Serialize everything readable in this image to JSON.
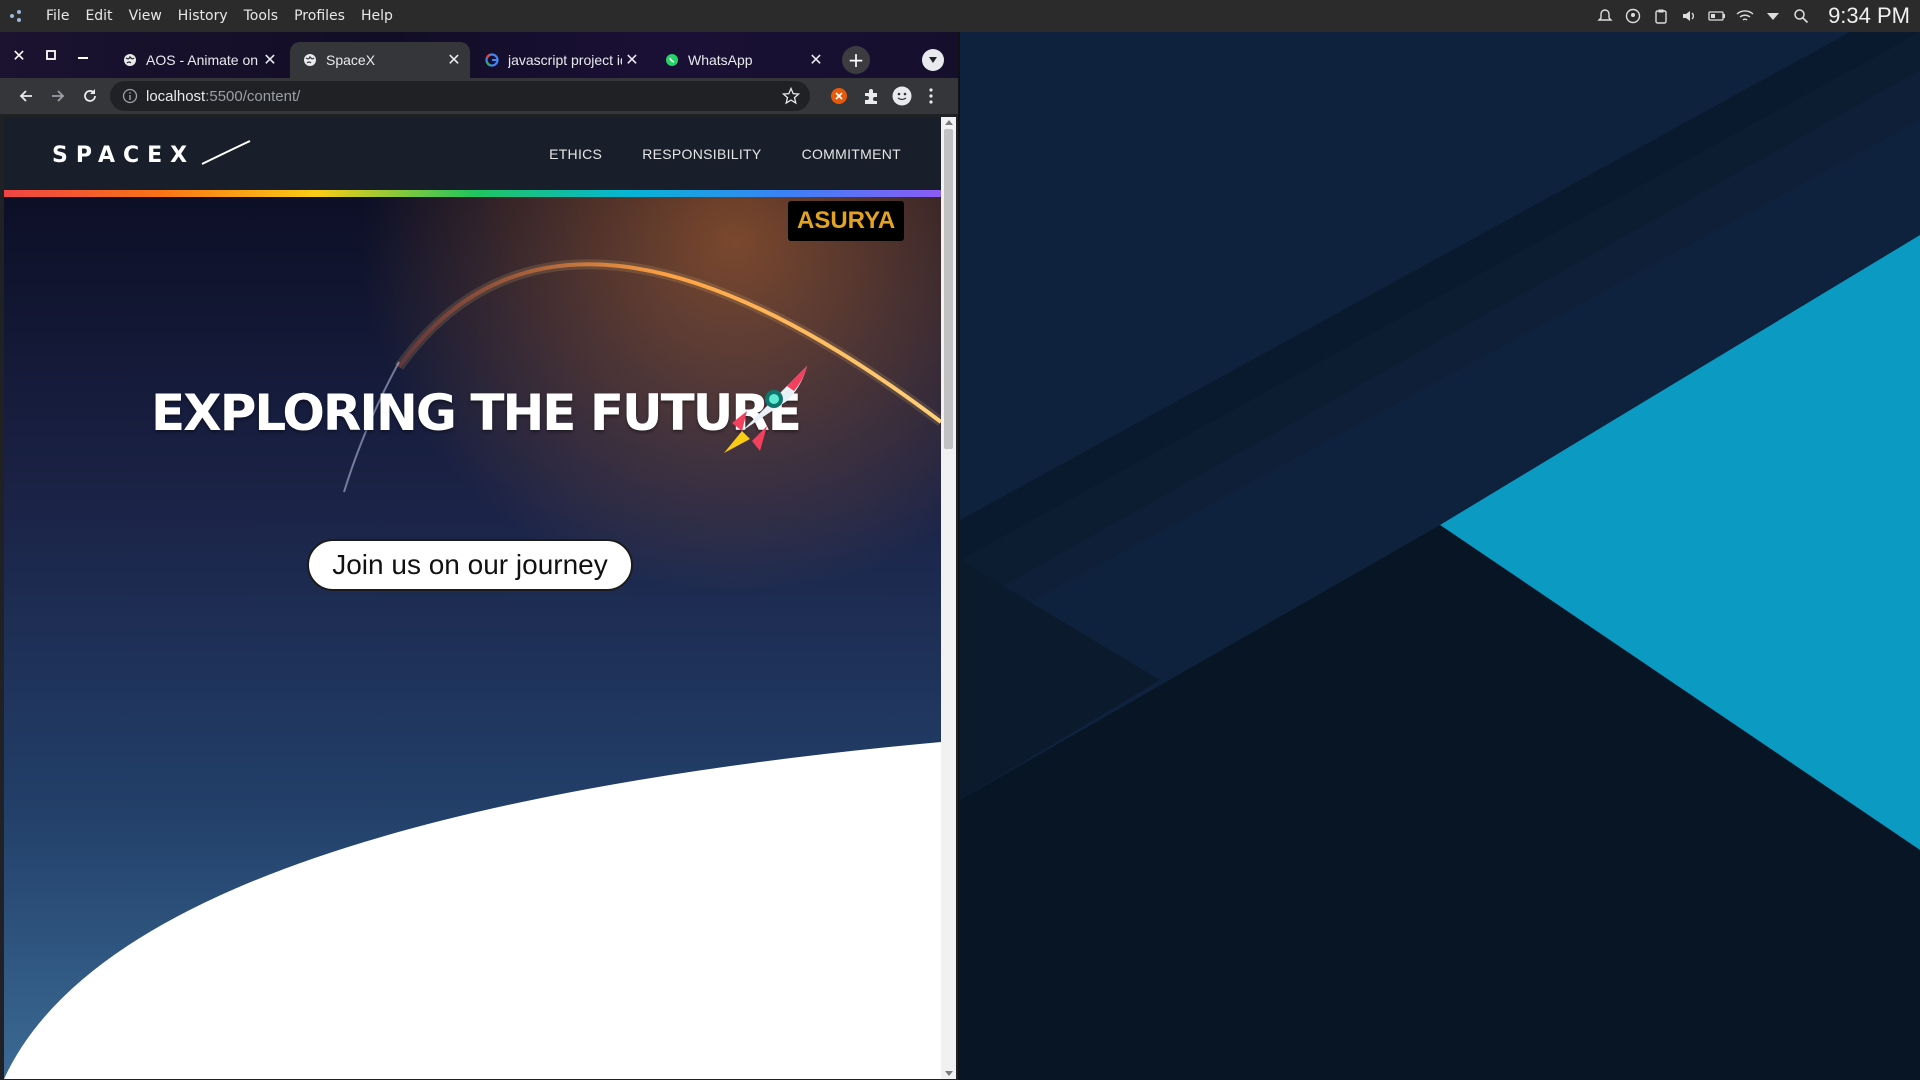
{
  "system_bar": {
    "menu": [
      "File",
      "Edit",
      "View",
      "History",
      "Tools",
      "Profiles",
      "Help"
    ],
    "tray_icons": [
      "notification-bell-icon",
      "vpn-icon",
      "clipboard-icon",
      "volume-icon",
      "battery-icon",
      "wifi-icon",
      "tray-expand-icon",
      "search-icon"
    ],
    "clock": "9:34 PM"
  },
  "browser": {
    "tabs": [
      {
        "title": "AOS - Animate on scroll library",
        "icon": "globe-icon",
        "active": false
      },
      {
        "title": "SpaceX",
        "icon": "globe-icon",
        "active": true
      },
      {
        "title": "javascript project ideas",
        "icon": "google-icon",
        "active": false
      },
      {
        "title": "WhatsApp",
        "icon": "whatsapp-icon",
        "active": false
      }
    ],
    "new_tab_symbol": "+",
    "url_host": "localhost",
    "url_path": ":5500/content/"
  },
  "page": {
    "logo_alt": "SPACEX",
    "nav_links": [
      "ETHICS",
      "RESPONSIBILITY",
      "COMMITMENT"
    ],
    "badge": "ASURYA",
    "headline": "EXPLORING THE FUTURE",
    "cta": "Join us on our journey"
  },
  "colors": {
    "accent_badge": "#e2a321",
    "wallpaper_cyan": "#0a9ac2",
    "wallpaper_navy": "#0f2440"
  }
}
